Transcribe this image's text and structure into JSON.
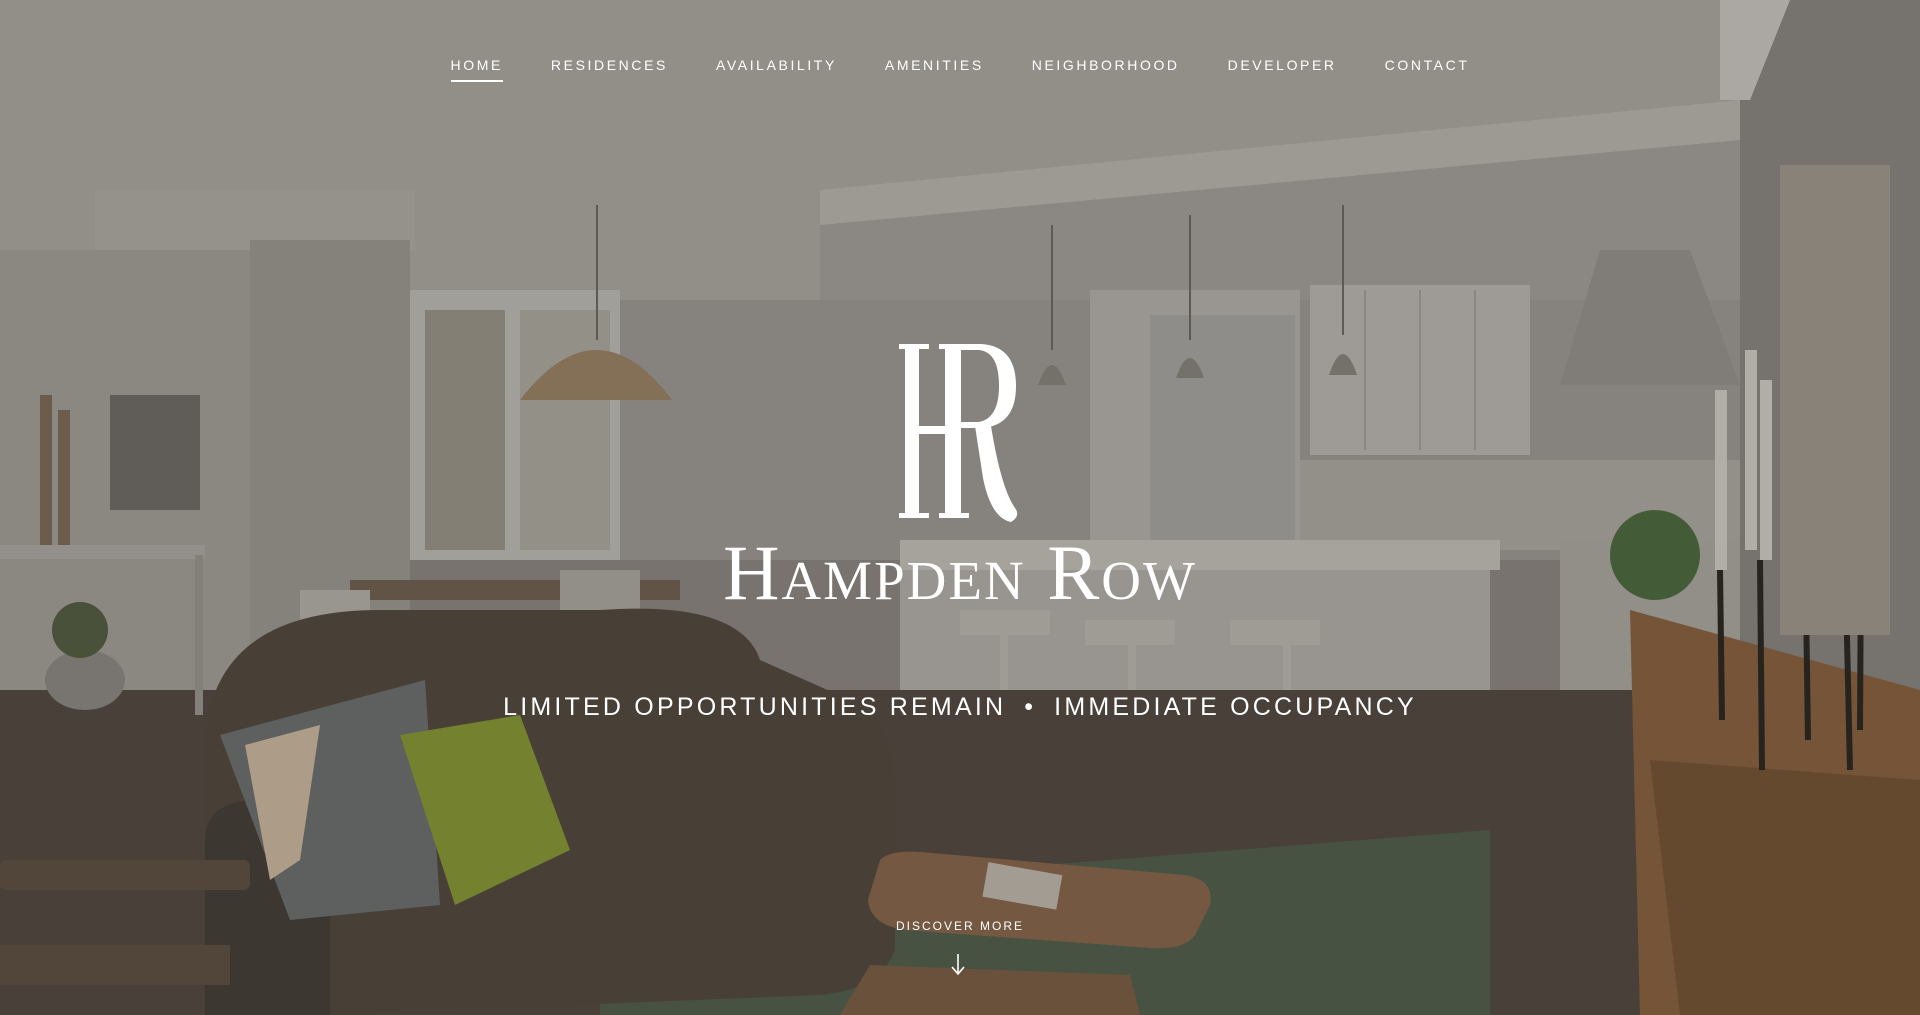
{
  "nav": {
    "items": [
      {
        "label": "HOME",
        "active": true
      },
      {
        "label": "RESIDENCES",
        "active": false
      },
      {
        "label": "AVAILABILITY",
        "active": false
      },
      {
        "label": "AMENITIES",
        "active": false
      },
      {
        "label": "NEIGHBORHOOD",
        "active": false
      },
      {
        "label": "DEVELOPER",
        "active": false
      },
      {
        "label": "CONTACT",
        "active": false
      }
    ]
  },
  "hero": {
    "logo_monogram": "HR",
    "brand_name": "Hampden Row",
    "tagline_left": "LIMITED OPPORTUNITIES REMAIN",
    "tagline_separator": "•",
    "tagline_right": "IMMEDIATE OCCUPANCY",
    "cta_label": "DISCOVER MORE",
    "cta_icon": "arrow-down-icon",
    "background_icon": "interior-photo"
  },
  "colors": {
    "text": "#ffffff",
    "overlay": "#5a5550"
  }
}
